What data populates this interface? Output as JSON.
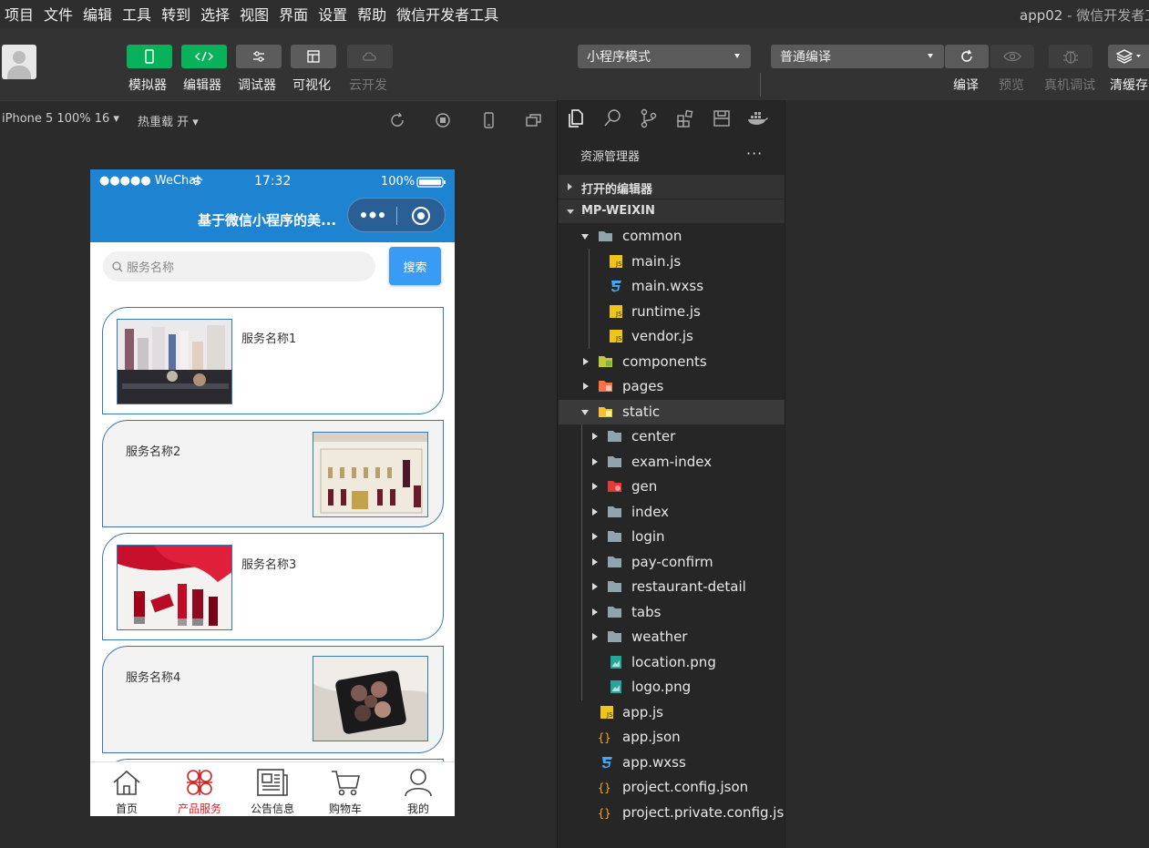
{
  "menu": [
    "项目",
    "文件",
    "编辑",
    "工具",
    "转到",
    "选择",
    "视图",
    "界面",
    "设置",
    "帮助",
    "微信开发者工具"
  ],
  "window": {
    "app": "app02",
    "sep": " - ",
    "name": "微信开发者工具"
  },
  "toolbar": {
    "simulator": "模拟器",
    "editor": "编辑器",
    "debugger": "调试器",
    "visual": "可视化",
    "cloud": "云开发",
    "mode": "小程序模式",
    "compile_mode": "普通编译",
    "compile": "编译",
    "preview": "预览",
    "real_debug": "真机调试",
    "clear_cache": "清缓存"
  },
  "simbar": {
    "device": "iPhone 5 100% 16",
    "hot_reload": "热重载 开"
  },
  "phone": {
    "status": {
      "carrier": "●●●●● WeChat",
      "time": "17:32",
      "battery": "100%"
    },
    "nav_title": "基于微信小程序的美...",
    "search": {
      "placeholder": "服务名称",
      "button": "搜索"
    },
    "items": [
      {
        "name": "服务名称1"
      },
      {
        "name": "服务名称2"
      },
      {
        "name": "服务名称3"
      },
      {
        "name": "服务名称4"
      }
    ],
    "tabs": [
      {
        "label": "首页",
        "icon": "home-icon"
      },
      {
        "label": "产品服务",
        "icon": "product-service-icon"
      },
      {
        "label": "公告信息",
        "icon": "news-icon"
      },
      {
        "label": "购物车",
        "icon": "cart-icon"
      },
      {
        "label": "我的",
        "icon": "user-icon"
      }
    ],
    "active_tab_color": "#d62222",
    "nav_color": "#1e84d2"
  },
  "explorer": {
    "title": "资源管理器",
    "more": "···",
    "open_editors": "打开的编辑器",
    "project": "MP-WEIXIN",
    "tree": [
      {
        "label": "common"
      },
      {
        "label": "main.js"
      },
      {
        "label": "main.wxss"
      },
      {
        "label": "runtime.js"
      },
      {
        "label": "vendor.js"
      },
      {
        "label": "components"
      },
      {
        "label": "pages"
      },
      {
        "label": "static"
      },
      {
        "label": "center"
      },
      {
        "label": "exam-index"
      },
      {
        "label": "gen"
      },
      {
        "label": "index"
      },
      {
        "label": "login"
      },
      {
        "label": "pay-confirm"
      },
      {
        "label": "restaurant-detail"
      },
      {
        "label": "tabs"
      },
      {
        "label": "weather"
      },
      {
        "label": "location.png"
      },
      {
        "label": "logo.png"
      },
      {
        "label": "app.js"
      },
      {
        "label": "app.json"
      },
      {
        "label": "app.wxss"
      },
      {
        "label": "project.config.json"
      },
      {
        "label": "project.private.config.js..."
      }
    ]
  }
}
